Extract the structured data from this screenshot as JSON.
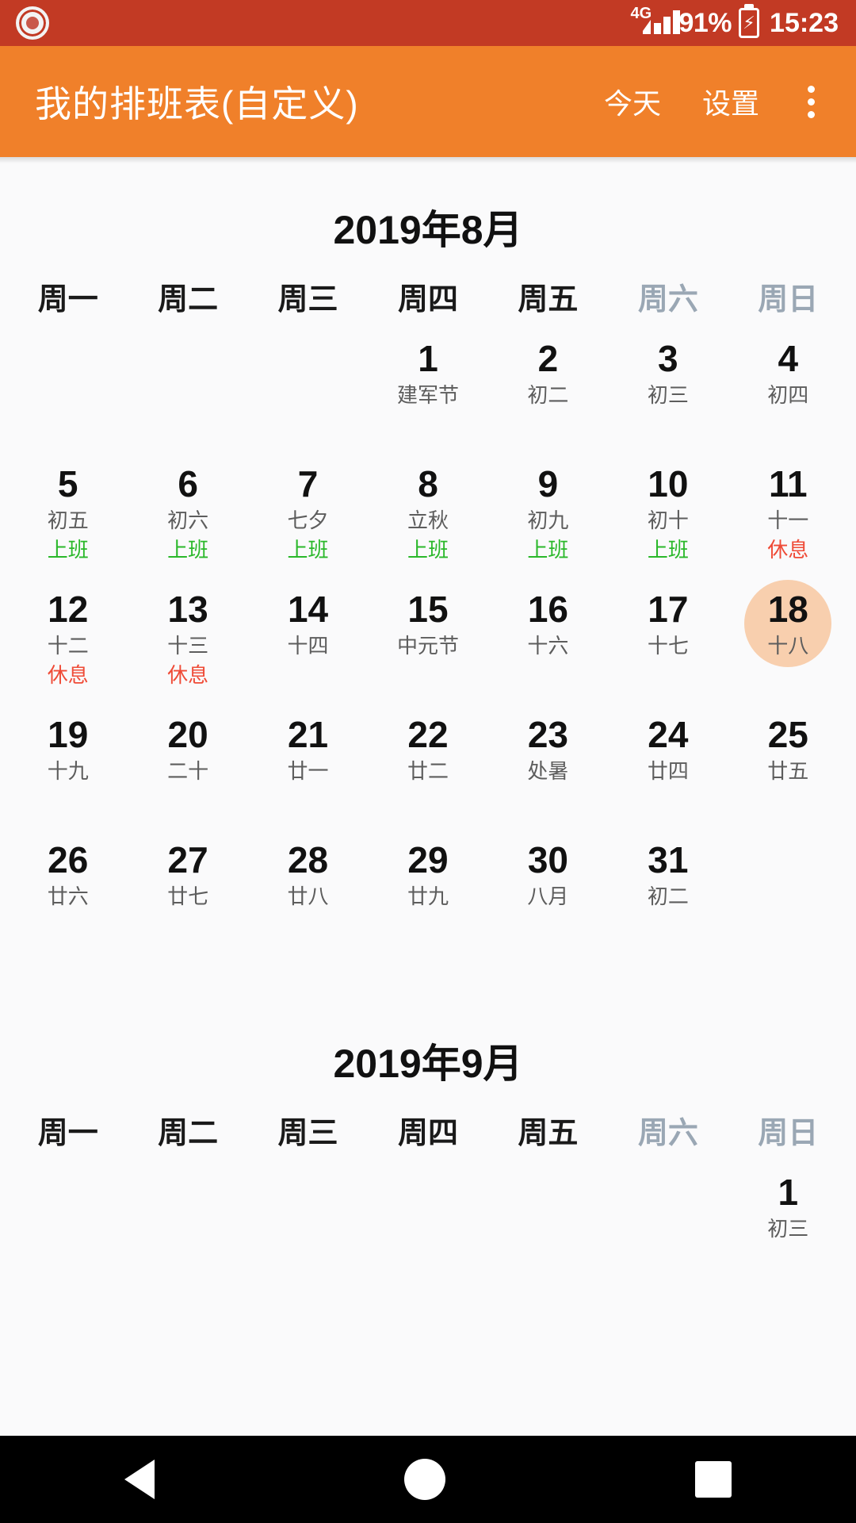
{
  "status_bar": {
    "recording_icon": "record-dot-icon",
    "network_label": "4G",
    "signal_icon": "signal-bars-icon",
    "battery_percent": "91%",
    "battery_icon": "battery-charging-icon",
    "battery_bolt": "⚡",
    "time": "15:23",
    "bg_color": "#c23a24"
  },
  "app_bar": {
    "title": "我的排班表(自定义)",
    "today_label": "今天",
    "settings_label": "设置",
    "overflow_icon": "kebab-menu-icon",
    "bg_color": "#f0802a"
  },
  "calendar": {
    "weekday_headers": [
      {
        "label": "周一",
        "weekend": false
      },
      {
        "label": "周二",
        "weekend": false
      },
      {
        "label": "周三",
        "weekend": false
      },
      {
        "label": "周四",
        "weekend": false
      },
      {
        "label": "周五",
        "weekend": false
      },
      {
        "label": "周六",
        "weekend": true
      },
      {
        "label": "周日",
        "weekend": true
      }
    ],
    "colors": {
      "work": "#2ab82a",
      "rest": "#ef4b37",
      "today_circle": "#f8cfae",
      "weekend_header": "#9aa7b4"
    },
    "months": [
      {
        "title": "2019年8月",
        "weeks": [
          [
            {
              "empty": true
            },
            {
              "empty": true
            },
            {
              "empty": true
            },
            {
              "day": "1",
              "lunar": "建军节"
            },
            {
              "day": "2",
              "lunar": "初二"
            },
            {
              "day": "3",
              "lunar": "初三"
            },
            {
              "day": "4",
              "lunar": "初四"
            }
          ],
          [
            {
              "day": "5",
              "lunar": "初五",
              "shift": "上班",
              "shift_type": "work"
            },
            {
              "day": "6",
              "lunar": "初六",
              "shift": "上班",
              "shift_type": "work"
            },
            {
              "day": "7",
              "lunar": "七夕",
              "shift": "上班",
              "shift_type": "work"
            },
            {
              "day": "8",
              "lunar": "立秋",
              "shift": "上班",
              "shift_type": "work"
            },
            {
              "day": "9",
              "lunar": "初九",
              "shift": "上班",
              "shift_type": "work"
            },
            {
              "day": "10",
              "lunar": "初十",
              "shift": "上班",
              "shift_type": "work"
            },
            {
              "day": "11",
              "lunar": "十一",
              "shift": "休息",
              "shift_type": "rest"
            }
          ],
          [
            {
              "day": "12",
              "lunar": "十二",
              "shift": "休息",
              "shift_type": "rest"
            },
            {
              "day": "13",
              "lunar": "十三",
              "shift": "休息",
              "shift_type": "rest"
            },
            {
              "day": "14",
              "lunar": "十四"
            },
            {
              "day": "15",
              "lunar": "中元节"
            },
            {
              "day": "16",
              "lunar": "十六"
            },
            {
              "day": "17",
              "lunar": "十七"
            },
            {
              "day": "18",
              "lunar": "十八",
              "today": true
            }
          ],
          [
            {
              "day": "19",
              "lunar": "十九"
            },
            {
              "day": "20",
              "lunar": "二十"
            },
            {
              "day": "21",
              "lunar": "廿一"
            },
            {
              "day": "22",
              "lunar": "廿二"
            },
            {
              "day": "23",
              "lunar": "处暑"
            },
            {
              "day": "24",
              "lunar": "廿四"
            },
            {
              "day": "25",
              "lunar": "廿五"
            }
          ],
          [
            {
              "day": "26",
              "lunar": "廿六"
            },
            {
              "day": "27",
              "lunar": "廿七"
            },
            {
              "day": "28",
              "lunar": "廿八"
            },
            {
              "day": "29",
              "lunar": "廿九"
            },
            {
              "day": "30",
              "lunar": "八月"
            },
            {
              "day": "31",
              "lunar": "初二"
            },
            {
              "empty": true
            }
          ]
        ]
      },
      {
        "title": "2019年9月",
        "weeks": [
          [
            {
              "empty": true
            },
            {
              "empty": true
            },
            {
              "empty": true
            },
            {
              "empty": true
            },
            {
              "empty": true
            },
            {
              "empty": true
            },
            {
              "day": "1",
              "lunar": "初三"
            }
          ]
        ]
      }
    ]
  },
  "nav_bar": {
    "back_icon": "back-triangle-icon",
    "home_icon": "home-circle-icon",
    "recents_icon": "recents-square-icon"
  }
}
